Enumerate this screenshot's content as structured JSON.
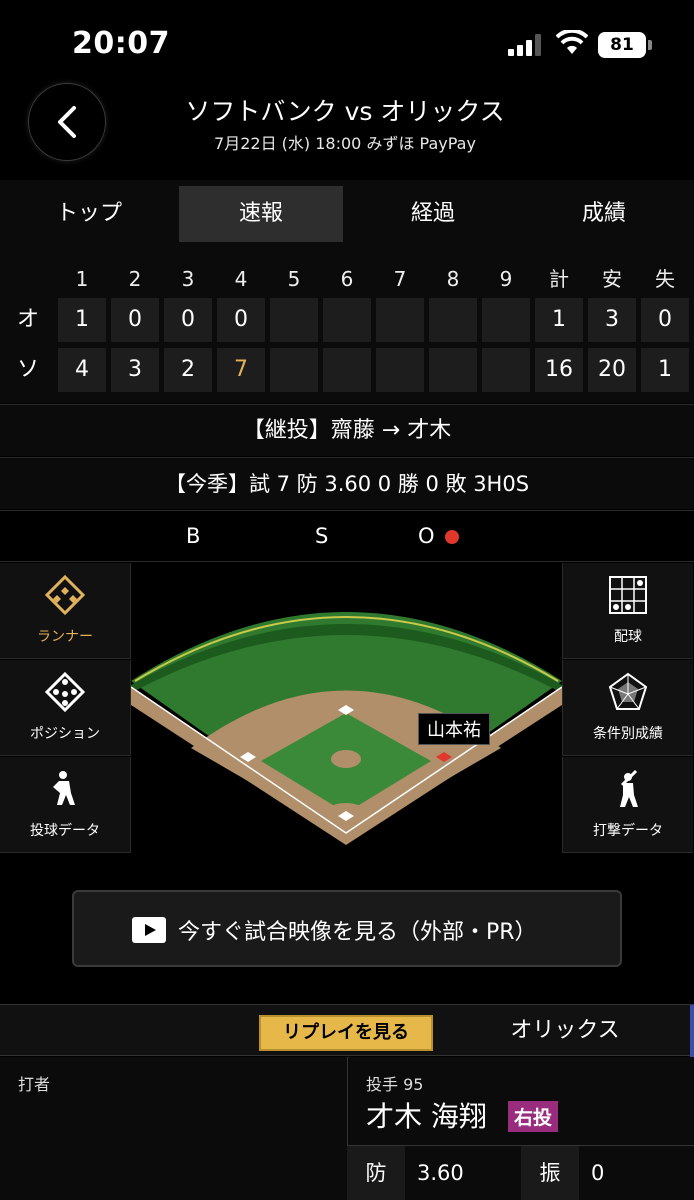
{
  "status": {
    "time": "20:07",
    "battery": "81"
  },
  "header": {
    "title": "ソフトバンク vs オリックス",
    "subtitle": "7月22日 (水) 18:00 みずほ PayPay"
  },
  "tabs": [
    "トップ",
    "速報",
    "経過",
    "成績"
  ],
  "scoreboard": {
    "headers": [
      "1",
      "2",
      "3",
      "4",
      "5",
      "6",
      "7",
      "8",
      "9",
      "計",
      "安",
      "失"
    ],
    "rows": [
      {
        "team": "オ",
        "innings": [
          "1",
          "0",
          "0",
          "0",
          "",
          "",
          "",
          "",
          ""
        ],
        "R": "1",
        "H": "3",
        "E": "0"
      },
      {
        "team": "ソ",
        "innings": [
          "4",
          "3",
          "2",
          "7",
          "",
          "",
          "",
          "",
          ""
        ],
        "R": "16",
        "H": "20",
        "E": "1"
      }
    ]
  },
  "relief": "【継投】齋藤 → 才木",
  "season": "【今季】試 7 防 3.60 0 勝 0 敗 3H0S",
  "bso": {
    "b": "B",
    "s": "S",
    "o": "O"
  },
  "side_left": [
    "ランナー",
    "ポジション",
    "投球データ"
  ],
  "side_right": [
    "配球",
    "条件別成績",
    "打撃データ"
  ],
  "field": {
    "runner": "山本祐"
  },
  "video_button": "今すぐ試合映像を見る（外部・PR）",
  "replay_button": "リプレイを見る",
  "team_right": "オリックス",
  "batter_label": "打者",
  "pitcher": {
    "label": "投手 95",
    "name": "才木 海翔",
    "badge": "右投"
  },
  "stats": {
    "era_label": "防",
    "era": "3.60",
    "k_label": "振",
    "k": "0"
  },
  "colors": {
    "accent": "#e0b25a",
    "out_dot": "#e0382b",
    "badge": "#9a2c7e",
    "replay": "#e6b84a"
  }
}
